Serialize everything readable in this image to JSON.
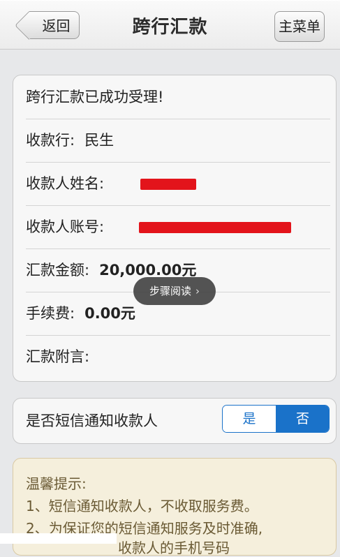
{
  "header": {
    "title": "跨行汇款",
    "back_label": "返回",
    "menu_label": "主菜单"
  },
  "result": {
    "message": "跨行汇款已成功受理!",
    "bank_label": "收款行:",
    "bank_value": "民生",
    "name_label": "收款人姓名:",
    "account_label": "收款人账号:",
    "amount_label": "汇款金额:",
    "amount_value": "20,000.00元",
    "fee_label": "手续费:",
    "fee_value": "0.00元",
    "note_label": "汇款附言:"
  },
  "overlay": {
    "step_read": "步骤阅读",
    "arrow_icon": "chevron-right-icon"
  },
  "sms": {
    "label": "是否短信通知收款人",
    "yes": "是",
    "no": "否",
    "selected": "否",
    "accent_color": "#1a72c9"
  },
  "tips": {
    "title": "温馨提示:",
    "line1": "1、短信通知收款人，不收取服务费。",
    "line2": "2、为保证您的短信通知服务及时准确,",
    "line3": "收款人的手机号码"
  },
  "colors": {
    "redaction": "#e3141b"
  }
}
